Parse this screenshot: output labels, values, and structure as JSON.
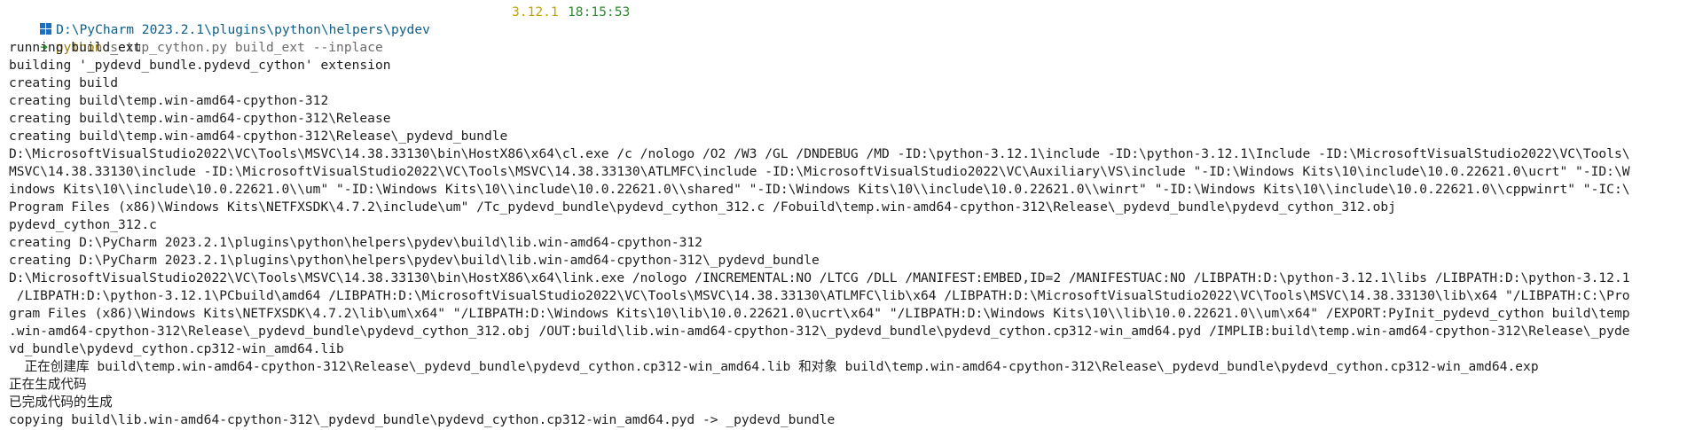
{
  "prompt": {
    "cwd": "D:\\PyCharm 2023.2.1\\plugins\\python\\helpers\\pydev",
    "python_version": "3.12.1",
    "time": "18:15:53",
    "arrow": "➜",
    "command": "python",
    "args": " setup_cython.py build_ext --inplace"
  },
  "colors": {
    "path": "#0b5f8a",
    "version": "#c4a200",
    "time": "#2e8b2e",
    "command": "#9c7c0a"
  },
  "icons": {
    "os": "windows-icon"
  },
  "output_lines": [
    "running build_ext",
    "building '_pydevd_bundle.pydevd_cython' extension",
    "creating build",
    "creating build\\temp.win-amd64-cpython-312",
    "creating build\\temp.win-amd64-cpython-312\\Release",
    "creating build\\temp.win-amd64-cpython-312\\Release\\_pydevd_bundle",
    "D:\\MicrosoftVisualStudio2022\\VC\\Tools\\MSVC\\14.38.33130\\bin\\HostX86\\x64\\cl.exe /c /nologo /O2 /W3 /GL /DNDEBUG /MD -ID:\\python-3.12.1\\include -ID:\\python-3.12.1\\Include -ID:\\MicrosoftVisualStudio2022\\VC\\Tools\\",
    "MSVC\\14.38.33130\\include -ID:\\MicrosoftVisualStudio2022\\VC\\Tools\\MSVC\\14.38.33130\\ATLMFC\\include -ID:\\MicrosoftVisualStudio2022\\VC\\Auxiliary\\VS\\include \"-ID:\\Windows Kits\\10\\include\\10.0.22621.0\\ucrt\" \"-ID:\\W",
    "indows Kits\\10\\\\include\\10.0.22621.0\\\\um\" \"-ID:\\Windows Kits\\10\\\\include\\10.0.22621.0\\\\shared\" \"-ID:\\Windows Kits\\10\\\\include\\10.0.22621.0\\\\winrt\" \"-ID:\\Windows Kits\\10\\\\include\\10.0.22621.0\\\\cppwinrt\" \"-IC:\\",
    "Program Files (x86)\\Windows Kits\\NETFXSDK\\4.7.2\\include\\um\" /Tc_pydevd_bundle\\pydevd_cython_312.c /Fobuild\\temp.win-amd64-cpython-312\\Release\\_pydevd_bundle\\pydevd_cython_312.obj",
    "pydevd_cython_312.c",
    "creating D:\\PyCharm 2023.2.1\\plugins\\python\\helpers\\pydev\\build\\lib.win-amd64-cpython-312",
    "creating D:\\PyCharm 2023.2.1\\plugins\\python\\helpers\\pydev\\build\\lib.win-amd64-cpython-312\\_pydevd_bundle",
    "D:\\MicrosoftVisualStudio2022\\VC\\Tools\\MSVC\\14.38.33130\\bin\\HostX86\\x64\\link.exe /nologo /INCREMENTAL:NO /LTCG /DLL /MANIFEST:EMBED,ID=2 /MANIFESTUAC:NO /LIBPATH:D:\\python-3.12.1\\libs /LIBPATH:D:\\python-3.12.1",
    " /LIBPATH:D:\\python-3.12.1\\PCbuild\\amd64 /LIBPATH:D:\\MicrosoftVisualStudio2022\\VC\\Tools\\MSVC\\14.38.33130\\ATLMFC\\lib\\x64 /LIBPATH:D:\\MicrosoftVisualStudio2022\\VC\\Tools\\MSVC\\14.38.33130\\lib\\x64 \"/LIBPATH:C:\\Pro",
    "gram Files (x86)\\Windows Kits\\NETFXSDK\\4.7.2\\lib\\um\\x64\" \"/LIBPATH:D:\\Windows Kits\\10\\lib\\10.0.22621.0\\ucrt\\x64\" \"/LIBPATH:D:\\Windows Kits\\10\\\\lib\\10.0.22621.0\\\\um\\x64\" /EXPORT:PyInit_pydevd_cython build\\temp",
    ".win-amd64-cpython-312\\Release\\_pydevd_bundle\\pydevd_cython_312.obj /OUT:build\\lib.win-amd64-cpython-312\\_pydevd_bundle\\pydevd_cython.cp312-win_amd64.pyd /IMPLIB:build\\temp.win-amd64-cpython-312\\Release\\_pyde",
    "vd_bundle\\pydevd_cython.cp312-win_amd64.lib",
    "  正在创建库 build\\temp.win-amd64-cpython-312\\Release\\_pydevd_bundle\\pydevd_cython.cp312-win_amd64.lib 和对象 build\\temp.win-amd64-cpython-312\\Release\\_pydevd_bundle\\pydevd_cython.cp312-win_amd64.exp",
    "正在生成代码",
    "已完成代码的生成",
    "copying build\\lib.win-amd64-cpython-312\\_pydevd_bundle\\pydevd_cython.cp312-win_amd64.pyd -> _pydevd_bundle"
  ]
}
